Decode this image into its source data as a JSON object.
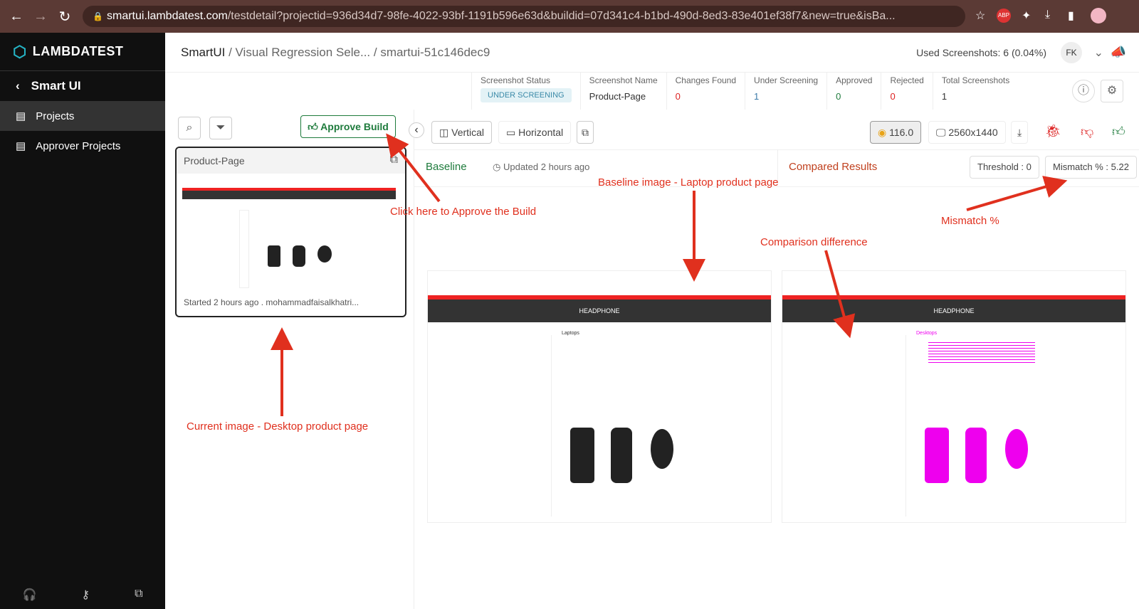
{
  "browser": {
    "url_host": "smartui.lambdatest.com",
    "url_path": "/testdetail?projectid=936d34d7-98fe-4022-93bf-1191b596e63d&buildid=07d341c4-b1bd-490d-8ed3-83e401ef38f7&new=true&isBa..."
  },
  "sidebar": {
    "logo": "LAMBDATEST",
    "back_label": "Smart UI",
    "items": [
      {
        "label": "Projects"
      },
      {
        "label": "Approver Projects"
      }
    ]
  },
  "header": {
    "crumb_root": "SmartUI",
    "crumb_project": " / Visual Regression Sele... / ",
    "crumb_build": "smartui-51c146dec9",
    "used": "Used Screenshots: 6 (0.04%)",
    "avatar": "FK"
  },
  "stats": [
    {
      "label": "Screenshot Status",
      "value": "UNDER SCREENING"
    },
    {
      "label": "Screenshot Name",
      "value": "Product-Page"
    },
    {
      "label": "Changes Found",
      "value": "0"
    },
    {
      "label": "Under Screening",
      "value": "1"
    },
    {
      "label": "Approved",
      "value": "0"
    },
    {
      "label": "Rejected",
      "value": "0"
    },
    {
      "label": "Total Screenshots",
      "value": "1"
    }
  ],
  "colors": {
    "accent": "#1e7b3c",
    "red": "#e0301e",
    "teal": "#25b3c4"
  },
  "left": {
    "approve_label": "Approve Build",
    "card_title": "Product-Page",
    "card_footer": "Started 2 hours ago  .  mohammadfaisalkhatri..."
  },
  "toolbar": {
    "vertical": "Vertical",
    "horizontal": "Horizontal",
    "browser_version": "116.0",
    "resolution": "2560x1440"
  },
  "compare": {
    "baseline": "Baseline",
    "updated": "Updated 2 hours ago",
    "compared": "Compared Results",
    "threshold": "Threshold : 0",
    "mismatch": "Mismatch % : 5.22"
  },
  "annotations": {
    "approve": "Click here to Approve the Build",
    "baseline": "Baseline image - Laptop product page",
    "mismatch": "Mismatch %",
    "difference": "Comparison difference",
    "current": "Current image - Desktop product page"
  },
  "shots": {
    "banner": "HEADPHONE",
    "baseline_heading": "Laptops",
    "compared_heading": "Desktops"
  }
}
